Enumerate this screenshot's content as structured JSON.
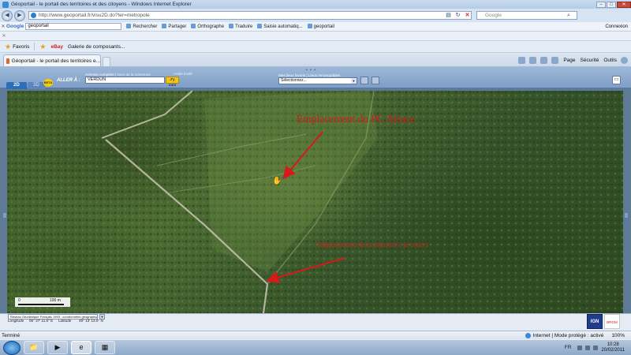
{
  "window": {
    "title": "Géoportail - le portail des territoires et des citoyens - Windows Internet Explorer",
    "minimize_label": "–",
    "maximize_label": "□",
    "close_label": "✕"
  },
  "address_bar": {
    "url": "http://www.geoportail.fr/visu2D.do?ter=metropole",
    "search_placeholder": "Google"
  },
  "google_toolbar": {
    "logo": "Google",
    "search_value": "geoportail",
    "items": [
      "Rechercher",
      "Partager",
      "Orthographe",
      "Traduire",
      "Saisie automatiq...",
      "geoportail"
    ],
    "connexion": "Connexion"
  },
  "favorites_bar": {
    "favoris_label": "Favoris",
    "items": [
      "eBay",
      "Galerie de composants..."
    ]
  },
  "tab": {
    "title": "Géoportail - le portail des territoires e..."
  },
  "command_bar": {
    "page": "Page",
    "securite": "Sécurité",
    "outils": "Outils"
  },
  "geoportail": {
    "btn_2d": "2D",
    "btn_3d": "3D",
    "beta": "BETA",
    "aller_a": "ALLER À :",
    "address_label": "Adresse complète",
    "commune_label": "Nom de la commune",
    "address_value": "VERDUN",
    "go_button": "J'y vais",
    "help_link": "»Aide invité",
    "favorites_label": "Mes lieux favoris",
    "favorites_sub": "Lieux remarquables",
    "favorites_select": "Sélectionnez..."
  },
  "map": {
    "annotation1": "Emplacement du PC Alsace",
    "annotation2": "Emplacement de la pancarte ( je crois )",
    "scale_start": "0",
    "scale_end": "100 m"
  },
  "map_footer": {
    "projection": "Réseau Géodésique Français 1993 : coordonnées géographiques",
    "longitude_label": "Longitude",
    "longitude_value": "05° 27' 11.5'' E",
    "latitude_label": "Latitude",
    "latitude_value": "49° 13' 13.0'' N",
    "logo_ign": "IGN",
    "logo_seal": "BRGM"
  },
  "status_bar": {
    "left": "Terminé",
    "zone": "Internet | Mode protégé : activé",
    "zoom": "100%"
  },
  "taskbar": {
    "lang": "FR",
    "time": "10:28",
    "date": "20/02/2011"
  }
}
